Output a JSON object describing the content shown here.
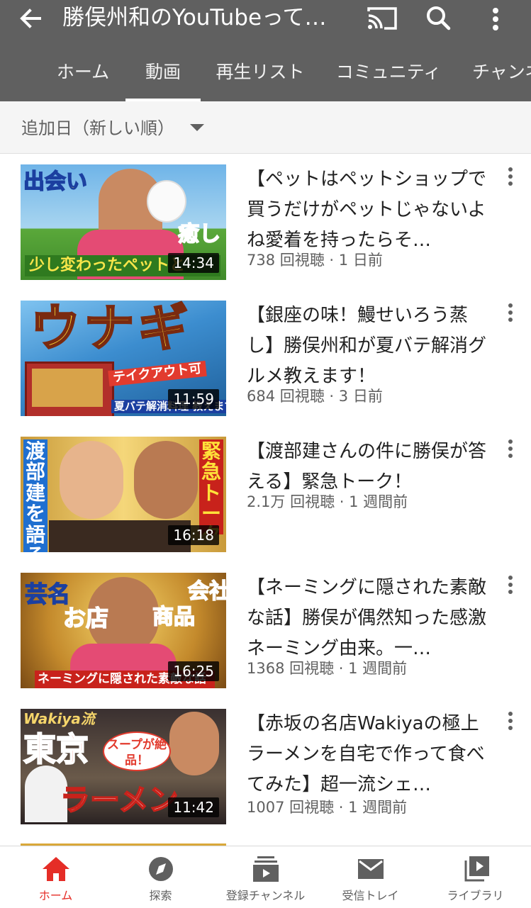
{
  "header": {
    "title": "勝俣州和のYouTubeって…",
    "tabs": [
      {
        "label": "ホーム",
        "active": false
      },
      {
        "label": "動画",
        "active": true
      },
      {
        "label": "再生リスト",
        "active": false
      },
      {
        "label": "コミュニティ",
        "active": false
      },
      {
        "label": "チャンネ",
        "active": false
      }
    ],
    "icons": [
      "back-arrow-icon",
      "cast-icon",
      "search-icon",
      "more-vert-icon"
    ]
  },
  "sort": {
    "label": "追加日（新しい順）"
  },
  "videos": [
    {
      "title": "【ペットはペットショップで買うだけがペットじゃないよね愛着を持ったらそ…",
      "meta": "738 回視聴 · 1 日前",
      "duration": "14:34",
      "thumb": {
        "big": "出会い",
        "side": "癒し",
        "banner": "少し変わったペットと"
      }
    },
    {
      "title": "【銀座の味！鰻せいろう蒸し】勝俣州和が夏バテ解消グルメ教えます！",
      "meta": "684 回視聴 · 3 日前",
      "duration": "11:59",
      "thumb": {
        "big": "ウナギ",
        "tag": "テイクアウト可",
        "banner": "夏バテ解消料理 教えます！"
      }
    },
    {
      "title": "【渡部建さんの件に勝俣が答える】緊急トーク！",
      "meta": "2.1万 回視聴 · 1 週間前",
      "duration": "16:18",
      "thumb": {
        "left": "渡部建を語る",
        "right": "緊急トーク"
      }
    },
    {
      "title": "【ネーミングに隠された素敵な話】勝俣が偶然知った感激ネーミング由来。一…",
      "meta": "1368 回視聴 · 1 週間前",
      "duration": "16:25",
      "thumb": {
        "w1": "芸名",
        "w2": "お店",
        "w3": "会社",
        "w4": "商品",
        "banner": "ネーミングに隠された素敵な話"
      }
    },
    {
      "title": "【赤坂の名店Wakiyaの極上ラーメンを自宅で作って食べてみた】超一流シェ…",
      "meta": "1007 回視聴 · 1 週間前",
      "duration": "11:42",
      "thumb": {
        "top": "Wakiya流",
        "big": "東京",
        "bubble": "スープが絶品！",
        "bottom": "ラーメン"
      }
    }
  ],
  "bottom_nav": [
    {
      "label": "ホーム",
      "icon": "home-icon",
      "active": true
    },
    {
      "label": "探索",
      "icon": "compass-icon",
      "active": false
    },
    {
      "label": "登録チャンネル",
      "icon": "subscriptions-icon",
      "active": false
    },
    {
      "label": "受信トレイ",
      "icon": "inbox-mail-icon",
      "active": false
    },
    {
      "label": "ライブラリ",
      "icon": "library-icon",
      "active": false
    }
  ],
  "colors": {
    "header_bg": "#606060",
    "accent_red": "#e52d27",
    "meta_text": "#606060"
  }
}
